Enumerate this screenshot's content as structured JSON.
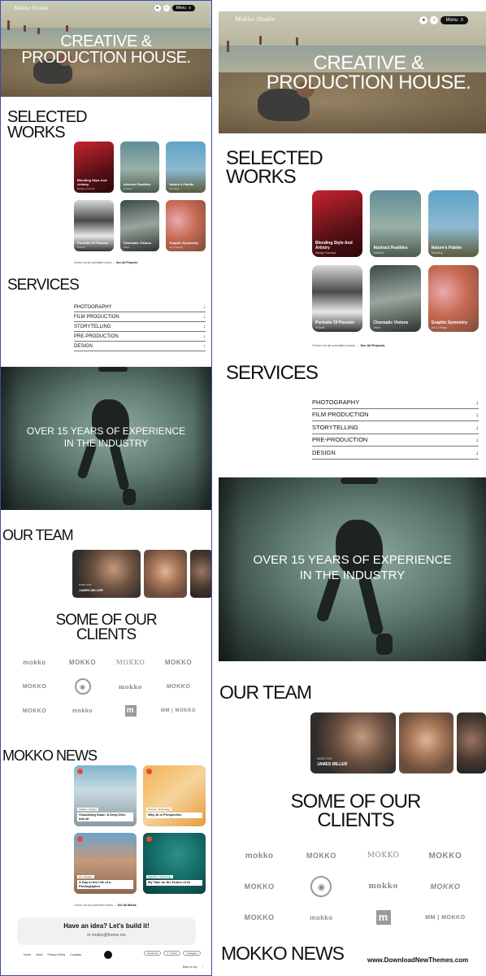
{
  "hero": {
    "logo_text": "Mokko Studio",
    "title_line1": "CREATIVE &",
    "title_line2": "PRODUCTION HOUSE.",
    "menu_label": "Menu"
  },
  "works": {
    "heading_line1": "SELECTED",
    "heading_line2": "WORKS",
    "items": [
      {
        "title": "Blending Style And Artistry",
        "sub": "Design Concept"
      },
      {
        "title": "Abstract Realities",
        "sub": "Abstract"
      },
      {
        "title": "Nature's Palette",
        "sub": "Branding"
      },
      {
        "title": "Portraits Of Passion",
        "sub": "Portrait"
      },
      {
        "title": "Cinematic Visions",
        "sub": "Video"
      },
      {
        "title": "Graphic Symmetry",
        "sub": "Art & Design"
      }
    ],
    "footer_text": "Check out all submitted works",
    "footer_link": "See All Projects"
  },
  "services": {
    "heading": "SERVICES",
    "items": [
      "PHOTOGRAPHY",
      "FILM PRODUCTION",
      "STORYTELLING",
      "PRE-PRODUCTION",
      "DESIGN"
    ]
  },
  "experience": {
    "line1": "OVER 15 YEARS OF EXPERIENCE",
    "line2": "IN THE INDUSTRY"
  },
  "team": {
    "heading": "OUR TEAM",
    "featured_role": "DIRECTOR",
    "featured_name": "JAMES MILLER"
  },
  "clients": {
    "heading_line1": "SOME OF OUR",
    "heading_line2": "CLIENTS",
    "logos": [
      "mokko",
      "MOKKO",
      "MOKKO",
      "MOKKO",
      "MOKKO",
      "",
      "mokko",
      "MOKKO",
      "MOKKO",
      "mokko",
      "m",
      "MM | MOKKO"
    ]
  },
  "news": {
    "heading": "MOKKO NEWS",
    "items": [
      {
        "tag": "Fashion, Design",
        "title": "Visualizing Solar: A Deep Dive into AI"
      },
      {
        "tag": "Finance, Technology",
        "title": "Why AI Is Perspective"
      },
      {
        "tag": "Art, Lifestyle",
        "title": "A Day in the Life of a Photographer"
      },
      {
        "tag": "Branding, Technology",
        "title": "My Take on the Future of AI"
      }
    ],
    "footer_text": "Check out our submitted works",
    "footer_link": "See All Works"
  },
  "cta": {
    "title": "Have an idea? Let's build it!",
    "email": "mokko@theme.me"
  },
  "footer": {
    "links": [
      "Home",
      "Work",
      "Privacy Policy",
      "Contacts"
    ],
    "socials": [
      "Facebook",
      "X / Twitter",
      "Instagram"
    ],
    "back_to_top": "Back to top"
  },
  "watermark": "www.DownloadNewThemes.com"
}
